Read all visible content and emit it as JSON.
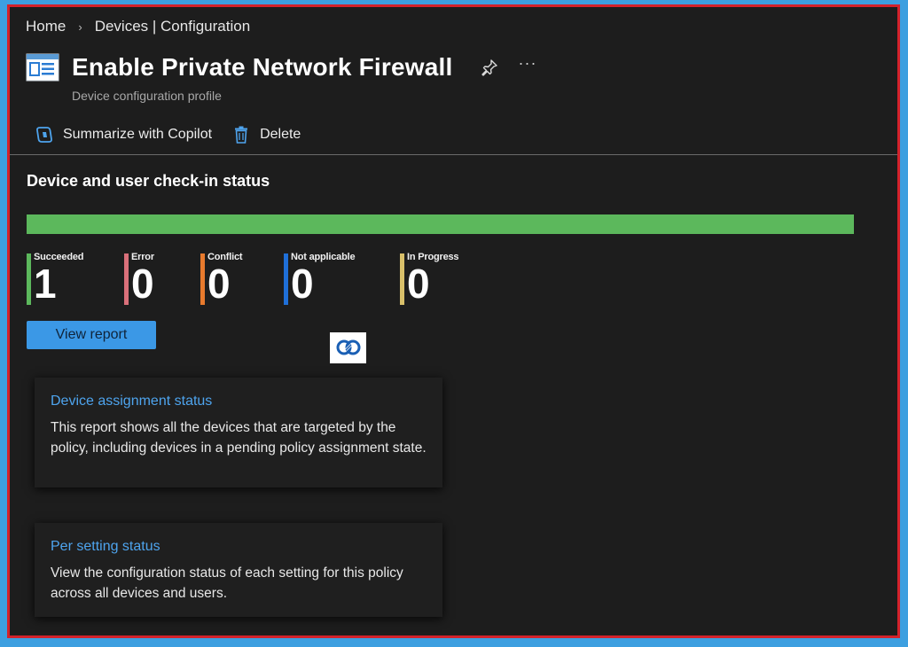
{
  "breadcrumb": {
    "home": "Home",
    "separator": "›",
    "current": "Devices | Configuration"
  },
  "header": {
    "title": "Enable Private Network Firewall",
    "subtitle": "Device configuration profile",
    "more": "···"
  },
  "toolbar": {
    "summarize_label": "Summarize with Copilot",
    "delete_label": "Delete"
  },
  "status": {
    "section_title": "Device and user check-in status",
    "succeeded_fraction": 1.0,
    "stats": [
      {
        "label": "Succeeded",
        "count": "1",
        "color": "#5cb85c"
      },
      {
        "label": "Error",
        "count": "0",
        "color": "#d9707a"
      },
      {
        "label": "Conflict",
        "count": "0",
        "color": "#e87a2d"
      },
      {
        "label": "Not applicable",
        "count": "0",
        "color": "#1f6fd8"
      },
      {
        "label": "In Progress",
        "count": "0",
        "color": "#d9c06a"
      }
    ],
    "view_report_label": "View report"
  },
  "cards": [
    {
      "title": "Device assignment status",
      "body": "This report shows all the devices that are targeted by the policy, including devices in a pending policy assignment state."
    },
    {
      "title": "Per setting status",
      "body": "View the configuration status of each setting for this policy across all devices and users."
    }
  ],
  "colors": {
    "accent": "#3b98e6",
    "link": "#4ea4ee",
    "success": "#5cb85c",
    "frame_border": "#d3222b",
    "outer_background": "#3d9fe0",
    "panel_background": "#1d1d1d"
  },
  "icons": [
    "profile-icon",
    "pin-icon",
    "more-icon",
    "copilot-icon",
    "trash-icon"
  ]
}
